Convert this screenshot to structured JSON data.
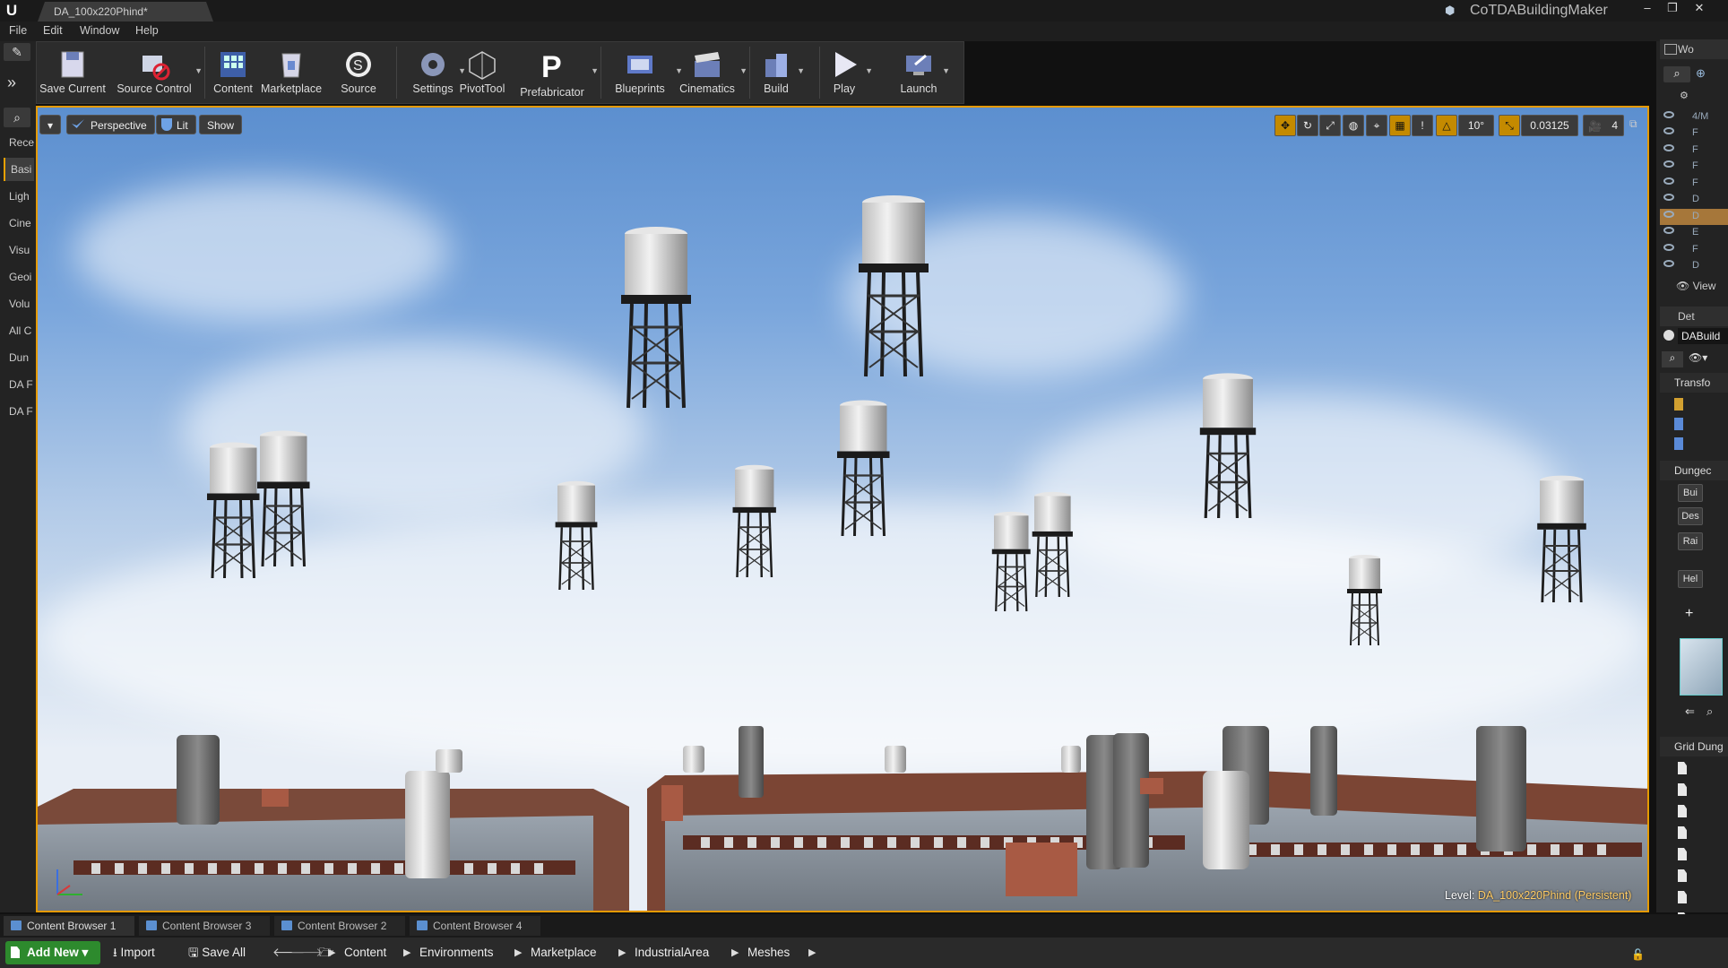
{
  "window": {
    "document_tab": "DA_100x220Phind*",
    "project_name": "CoTDABuildingMaker",
    "controls": [
      "–",
      "❐",
      "✕"
    ]
  },
  "menu": [
    "File",
    "Edit",
    "Window",
    "Help"
  ],
  "toolbar": [
    {
      "label": "Save Current",
      "icon": "save-icon",
      "dropdown": false
    },
    {
      "label": "Source Control",
      "icon": "source-control-icon",
      "dropdown": true
    },
    {
      "label": "Content",
      "icon": "content-icon",
      "dropdown": false
    },
    {
      "label": "Marketplace",
      "icon": "marketplace-icon",
      "dropdown": false
    },
    {
      "label": "Source",
      "icon": "source-icon",
      "dropdown": false
    },
    {
      "label": "Settings",
      "icon": "settings-icon",
      "dropdown": true
    },
    {
      "label": "PivotTool",
      "icon": "pivot-tool-icon",
      "dropdown": false
    },
    {
      "label": "Prefabricator",
      "icon": "prefabricator-icon",
      "dropdown": true
    },
    {
      "label": "Blueprints",
      "icon": "blueprints-icon",
      "dropdown": true
    },
    {
      "label": "Cinematics",
      "icon": "cinematics-icon",
      "dropdown": true
    },
    {
      "label": "Build",
      "icon": "build-icon",
      "dropdown": true
    },
    {
      "label": "Play",
      "icon": "play-icon",
      "dropdown": true
    },
    {
      "label": "Launch",
      "icon": "launch-icon",
      "dropdown": true
    }
  ],
  "place_modes": {
    "categories": [
      "Rece",
      "Basi",
      "Ligh",
      "Cine",
      "Visu",
      "Geoi",
      "Volu",
      "All C",
      "Dun",
      "DA F",
      "DA F"
    ],
    "selected_index": 1
  },
  "viewport": {
    "view_mode": "Perspective",
    "lighting": "Lit",
    "show": "Show",
    "rotation_snap": "10°",
    "scale_snap": "0.03125",
    "camera_speed": "4",
    "level_label": "Level:",
    "level_name": "DA_100x220Phind (Persistent)"
  },
  "outliner": {
    "tab": "Wo",
    "view_options": "View",
    "rows": [
      "F",
      "F",
      "F",
      "F",
      "D",
      "D",
      "E",
      "F",
      "D"
    ],
    "top_row": "4/M",
    "selected_index": 5
  },
  "details": {
    "tab": "Det",
    "actor_name": "DABuild",
    "sections": [
      "Transfo",
      "Dungec",
      "Grid Dung"
    ],
    "buttons": [
      "Bui",
      "Des",
      "Rai",
      "Hel"
    ]
  },
  "content_browser": {
    "tabs": [
      "Content Browser 1",
      "Content Browser 3",
      "Content Browser 2",
      "Content Browser 4"
    ],
    "active_tab": 0,
    "add_new": "Add New",
    "import": "Import",
    "save_all": "Save All",
    "breadcrumb": [
      "Content",
      "Environments",
      "Marketplace",
      "IndustrialArea",
      "Meshes"
    ]
  }
}
